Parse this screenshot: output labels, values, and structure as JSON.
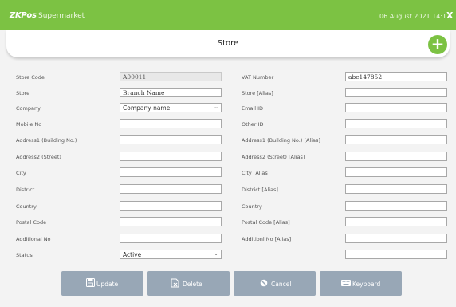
{
  "app": {
    "logo": "ZKPos",
    "name": "Supermarket",
    "datetime": "06 August 2021 14:12",
    "close": "X"
  },
  "header": {
    "title": "Store",
    "add": "+"
  },
  "form": {
    "left": [
      {
        "label": "Store Code",
        "value": "A00011"
      },
      {
        "label": "Store",
        "value": "Branch Name"
      },
      {
        "label": "Company",
        "value": "Company name"
      },
      {
        "label": "Mobile No",
        "value": ""
      },
      {
        "label": "Address1 (Building No.)",
        "value": ""
      },
      {
        "label": "Address2 (Street)",
        "value": ""
      },
      {
        "label": "City",
        "value": ""
      },
      {
        "label": "District",
        "value": ""
      },
      {
        "label": "Country",
        "value": ""
      },
      {
        "label": "Postal Code",
        "value": ""
      },
      {
        "label": "Additional No",
        "value": ""
      },
      {
        "label": "Status",
        "value": "Active"
      }
    ],
    "right": [
      {
        "label": "VAT Number",
        "value": "abc147852"
      },
      {
        "label": "Store [Alias]",
        "value": ""
      },
      {
        "label": "Email ID",
        "value": ""
      },
      {
        "label": "Other ID",
        "value": ""
      },
      {
        "label": "Address1 (Building No.) [Alias]",
        "value": ""
      },
      {
        "label": "Address2 (Street) [Alias]",
        "value": ""
      },
      {
        "label": "City [Alias]",
        "value": ""
      },
      {
        "label": "District [Alias]",
        "value": ""
      },
      {
        "label": "Country",
        "value": ""
      },
      {
        "label": "Postal Code [Alias]",
        "value": ""
      },
      {
        "label": "Additionl No [Alias]",
        "value": ""
      },
      {
        "label": "",
        "value": ""
      }
    ]
  },
  "buttons": {
    "update": "Update",
    "delete": "Delete",
    "cancel": "Cancel",
    "keyboard": "Keyboard"
  },
  "colors": {
    "accent": "#7cc243",
    "button": "#98a7b6",
    "background": "#f3f3f3"
  },
  "icons": [
    "save-icon",
    "delete-icon",
    "cancel-icon",
    "keyboard-icon",
    "plus-icon",
    "close-icon",
    "chevron-down-icon"
  ]
}
